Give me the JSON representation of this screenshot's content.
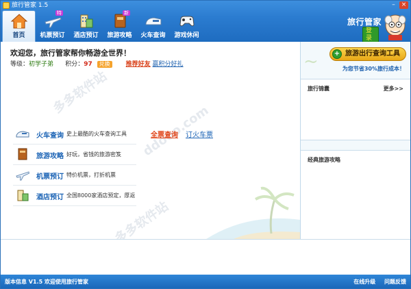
{
  "window": {
    "title": "旅行管家 1.5",
    "min_label": "–",
    "close_label": "×"
  },
  "nav": {
    "items": [
      {
        "label": "首页",
        "icon": "home-icon"
      },
      {
        "label": "机票预订",
        "icon": "plane-icon",
        "badge": "特"
      },
      {
        "label": "酒店预订",
        "icon": "hotel-icon"
      },
      {
        "label": "旅游攻略",
        "icon": "guidebook-icon",
        "badge": "新"
      },
      {
        "label": "火车查询",
        "icon": "train-icon"
      },
      {
        "label": "游戏休闲",
        "icon": "gamepad-icon"
      }
    ]
  },
  "brand": {
    "name": "旅行管家",
    "login_label": "登录"
  },
  "welcome": {
    "message": "欢迎您，旅行管家帮你畅游全世界！",
    "level_label": "等级：",
    "level_value": "初学子弟",
    "points_label": "积分：",
    "points_value": "97",
    "exchange_label": "兑换",
    "recommend_label": "推荐好友",
    "bonus_label": "赢积分好礼"
  },
  "services": [
    {
      "name": "火车查询",
      "desc": "史上最酷的火车查询工具",
      "icon": "train-icon"
    },
    {
      "name": "旅游攻略",
      "desc": "好玩，省钱的旅游密笈",
      "icon": "guidebook-icon"
    },
    {
      "name": "机票预订",
      "desc": "特价机票，打折机票",
      "icon": "plane-icon"
    },
    {
      "name": "酒店预订",
      "desc": "全国8000家酒店预定，厚返",
      "icon": "hotel-icon"
    }
  ],
  "train_links": {
    "full_query": "全票查询",
    "book": "订火车票"
  },
  "sidebar": {
    "tool_button": "旅游出行查询工具",
    "tool_sub": "为您节省30%旅行成本！",
    "section1_title": "旅行锦囊",
    "section1_more": "更多>>",
    "section2_title": "经典旅游攻略"
  },
  "statusbar": {
    "version_label": "版本信息",
    "version_text": "V1.5 欢迎使用旅行管家",
    "upgrade_label": "在线升级",
    "feedback_label": "问题反馈"
  },
  "colors": {
    "accent": "#2b7cd0",
    "link": "#1b63b5",
    "highlight": "#e0471c"
  }
}
